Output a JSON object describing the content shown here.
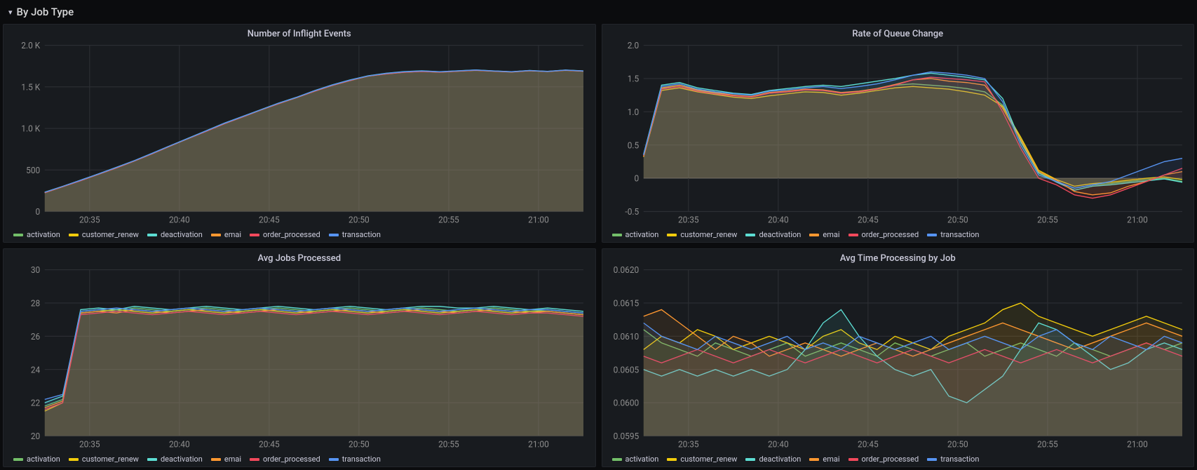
{
  "section": {
    "title": "By Job Type"
  },
  "series_meta": [
    {
      "name": "activation",
      "color": "#73BF69"
    },
    {
      "name": "customer_renew",
      "color": "#F2CC0C"
    },
    {
      "name": "deactivation",
      "color": "#5DDDD3"
    },
    {
      "name": "emai",
      "color": "#FF9830"
    },
    {
      "name": "order_processed",
      "color": "#F2495C"
    },
    {
      "name": "transaction",
      "color": "#5794F2"
    }
  ],
  "x_ticks": [
    "20:35",
    "20:40",
    "20:45",
    "20:50",
    "20:55",
    "21:00"
  ],
  "chart_data": [
    {
      "id": "inflight",
      "type": "line",
      "title": "Number of Inflight Events",
      "xlabel": "",
      "ylabel": "",
      "ylim": [
        0,
        2000
      ],
      "y_ticks": [
        0,
        500,
        1000,
        1500,
        2000
      ],
      "y_tick_labels": [
        "0",
        "500",
        "1.0 K",
        "1.5 K",
        "2.0 K"
      ],
      "x": [
        0,
        1,
        2,
        3,
        4,
        5,
        6,
        7,
        8,
        9,
        10,
        11,
        12,
        13,
        14,
        15,
        16,
        17,
        18,
        19,
        20,
        21,
        22,
        23,
        24,
        25,
        26,
        27,
        28,
        29,
        30
      ],
      "series": [
        {
          "name": "activation",
          "values": [
            230,
            300,
            375,
            450,
            530,
            610,
            700,
            790,
            880,
            970,
            1060,
            1140,
            1220,
            1300,
            1370,
            1450,
            1520,
            1580,
            1630,
            1660,
            1680,
            1690,
            1680,
            1690,
            1700,
            1690,
            1680,
            1695,
            1685,
            1700,
            1690
          ]
        },
        {
          "name": "customer_renew",
          "values": [
            225,
            298,
            370,
            448,
            525,
            608,
            695,
            788,
            878,
            965,
            1055,
            1135,
            1218,
            1295,
            1368,
            1445,
            1515,
            1575,
            1628,
            1655,
            1675,
            1685,
            1676,
            1688,
            1698,
            1688,
            1678,
            1693,
            1683,
            1698,
            1688
          ]
        },
        {
          "name": "deactivation",
          "values": [
            233,
            303,
            378,
            453,
            533,
            613,
            703,
            793,
            883,
            973,
            1063,
            1143,
            1223,
            1303,
            1373,
            1453,
            1523,
            1583,
            1633,
            1663,
            1683,
            1693,
            1682,
            1693,
            1703,
            1692,
            1682,
            1697,
            1687,
            1702,
            1692
          ]
        },
        {
          "name": "emai",
          "values": [
            228,
            301,
            373,
            451,
            528,
            611,
            698,
            791,
            880,
            968,
            1058,
            1138,
            1220,
            1298,
            1370,
            1448,
            1518,
            1578,
            1630,
            1658,
            1678,
            1688,
            1678,
            1690,
            1700,
            1690,
            1680,
            1695,
            1685,
            1700,
            1690
          ]
        },
        {
          "name": "order_processed",
          "values": [
            226,
            299,
            371,
            449,
            526,
            609,
            696,
            789,
            879,
            966,
            1056,
            1136,
            1219,
            1296,
            1369,
            1446,
            1516,
            1576,
            1629,
            1656,
            1676,
            1686,
            1677,
            1689,
            1699,
            1689,
            1679,
            1694,
            1684,
            1699,
            1689
          ]
        },
        {
          "name": "transaction",
          "values": [
            231,
            302,
            376,
            452,
            531,
            612,
            701,
            792,
            881,
            971,
            1061,
            1141,
            1221,
            1301,
            1371,
            1451,
            1521,
            1581,
            1631,
            1661,
            1681,
            1691,
            1681,
            1692,
            1702,
            1691,
            1681,
            1696,
            1686,
            1701,
            1691
          ]
        }
      ]
    },
    {
      "id": "queue-rate",
      "type": "line",
      "title": "Rate of Queue Change",
      "xlabel": "",
      "ylabel": "",
      "ylim": [
        -0.5,
        2.0
      ],
      "y_ticks": [
        -0.5,
        0,
        0.5,
        1.0,
        1.5,
        2.0
      ],
      "y_tick_labels": [
        "-0.5",
        "0",
        "0.5",
        "1.0",
        "1.5",
        "2.0"
      ],
      "x": [
        0,
        1,
        2,
        3,
        4,
        5,
        6,
        7,
        8,
        9,
        10,
        11,
        12,
        13,
        14,
        15,
        16,
        17,
        18,
        19,
        20,
        21,
        22,
        23,
        24,
        25,
        26,
        27,
        28,
        29,
        30
      ],
      "series": [
        {
          "name": "activation",
          "values": [
            0.35,
            1.35,
            1.4,
            1.32,
            1.28,
            1.25,
            1.22,
            1.28,
            1.3,
            1.33,
            1.32,
            1.28,
            1.3,
            1.34,
            1.4,
            1.42,
            1.4,
            1.38,
            1.35,
            1.3,
            1.1,
            0.6,
            0.1,
            -0.05,
            -0.15,
            -0.1,
            -0.08,
            -0.05,
            -0.02,
            0.0,
            -0.05
          ]
        },
        {
          "name": "customer_renew",
          "values": [
            0.32,
            1.32,
            1.36,
            1.3,
            1.26,
            1.22,
            1.2,
            1.24,
            1.27,
            1.3,
            1.29,
            1.25,
            1.28,
            1.32,
            1.36,
            1.38,
            1.36,
            1.34,
            1.3,
            1.25,
            1.08,
            0.62,
            0.12,
            -0.02,
            -0.12,
            -0.08,
            -0.06,
            -0.03,
            0.0,
            0.02,
            -0.02
          ]
        },
        {
          "name": "deactivation",
          "values": [
            0.36,
            1.4,
            1.44,
            1.36,
            1.32,
            1.28,
            1.26,
            1.32,
            1.35,
            1.38,
            1.4,
            1.38,
            1.42,
            1.46,
            1.5,
            1.55,
            1.58,
            1.55,
            1.52,
            1.48,
            1.2,
            0.55,
            0.08,
            -0.06,
            -0.18,
            -0.12,
            -0.1,
            -0.07,
            -0.04,
            -0.01,
            -0.06
          ]
        },
        {
          "name": "emai",
          "values": [
            0.33,
            1.36,
            1.4,
            1.33,
            1.29,
            1.25,
            1.23,
            1.29,
            1.31,
            1.34,
            1.33,
            1.29,
            1.31,
            1.35,
            1.41,
            1.48,
            1.5,
            1.46,
            1.44,
            1.4,
            1.05,
            0.58,
            0.1,
            -0.03,
            -0.2,
            -0.25,
            -0.22,
            -0.12,
            -0.05,
            0.05,
            0.1
          ]
        },
        {
          "name": "order_processed",
          "values": [
            0.34,
            1.34,
            1.38,
            1.31,
            1.27,
            1.24,
            1.22,
            1.28,
            1.3,
            1.33,
            1.32,
            1.28,
            1.3,
            1.34,
            1.4,
            1.48,
            1.52,
            1.5,
            1.48,
            1.45,
            1.0,
            0.45,
            0.0,
            -0.1,
            -0.25,
            -0.3,
            -0.25,
            -0.15,
            -0.05,
            0.05,
            0.15
          ]
        },
        {
          "name": "transaction",
          "values": [
            0.35,
            1.38,
            1.42,
            1.34,
            1.3,
            1.27,
            1.25,
            1.31,
            1.33,
            1.36,
            1.38,
            1.35,
            1.38,
            1.42,
            1.48,
            1.55,
            1.6,
            1.58,
            1.55,
            1.5,
            1.15,
            0.5,
            0.05,
            -0.05,
            -0.15,
            -0.1,
            -0.05,
            0.05,
            0.15,
            0.25,
            0.3
          ]
        }
      ]
    },
    {
      "id": "avg-jobs",
      "type": "line",
      "title": "Avg Jobs Processed",
      "xlabel": "",
      "ylabel": "",
      "ylim": [
        20,
        30
      ],
      "y_ticks": [
        20,
        22,
        24,
        26,
        28,
        30
      ],
      "y_tick_labels": [
        "20",
        "22",
        "24",
        "26",
        "28",
        "30"
      ],
      "x": [
        0,
        1,
        2,
        3,
        4,
        5,
        6,
        7,
        8,
        9,
        10,
        11,
        12,
        13,
        14,
        15,
        16,
        17,
        18,
        19,
        20,
        21,
        22,
        23,
        24,
        25,
        26,
        27,
        28,
        29,
        30
      ],
      "series": [
        {
          "name": "activation",
          "values": [
            21.8,
            22.2,
            27.5,
            27.6,
            27.5,
            27.7,
            27.6,
            27.5,
            27.6,
            27.7,
            27.6,
            27.5,
            27.6,
            27.7,
            27.6,
            27.5,
            27.6,
            27.7,
            27.6,
            27.5,
            27.6,
            27.7,
            27.6,
            27.5,
            27.6,
            27.7,
            27.6,
            27.5,
            27.6,
            27.5,
            27.4
          ]
        },
        {
          "name": "customer_renew",
          "values": [
            21.5,
            22.0,
            27.4,
            27.5,
            27.6,
            27.5,
            27.4,
            27.5,
            27.6,
            27.5,
            27.4,
            27.5,
            27.6,
            27.5,
            27.4,
            27.5,
            27.6,
            27.5,
            27.4,
            27.5,
            27.6,
            27.5,
            27.4,
            27.5,
            27.6,
            27.5,
            27.4,
            27.5,
            27.5,
            27.4,
            27.3
          ]
        },
        {
          "name": "deactivation",
          "values": [
            22.0,
            22.4,
            27.6,
            27.7,
            27.6,
            27.8,
            27.7,
            27.6,
            27.7,
            27.8,
            27.7,
            27.6,
            27.7,
            27.8,
            27.7,
            27.6,
            27.7,
            27.8,
            27.7,
            27.6,
            27.7,
            27.8,
            27.8,
            27.7,
            27.7,
            27.8,
            27.7,
            27.6,
            27.7,
            27.6,
            27.5
          ]
        },
        {
          "name": "emai",
          "values": [
            21.7,
            22.1,
            27.4,
            27.5,
            27.4,
            27.6,
            27.5,
            27.4,
            27.5,
            27.6,
            27.5,
            27.4,
            27.5,
            27.6,
            27.5,
            27.4,
            27.5,
            27.6,
            27.5,
            27.4,
            27.5,
            27.6,
            27.5,
            27.4,
            27.5,
            27.6,
            27.5,
            27.4,
            27.5,
            27.4,
            27.3
          ]
        },
        {
          "name": "order_processed",
          "values": [
            21.6,
            22.0,
            27.3,
            27.4,
            27.5,
            27.4,
            27.3,
            27.4,
            27.5,
            27.4,
            27.3,
            27.4,
            27.5,
            27.4,
            27.3,
            27.4,
            27.5,
            27.4,
            27.3,
            27.4,
            27.5,
            27.4,
            27.3,
            27.4,
            27.5,
            27.4,
            27.3,
            27.4,
            27.4,
            27.3,
            27.2
          ]
        },
        {
          "name": "transaction",
          "values": [
            22.2,
            22.5,
            27.5,
            27.6,
            27.7,
            27.6,
            27.5,
            27.6,
            27.7,
            27.6,
            27.5,
            27.6,
            27.7,
            27.6,
            27.5,
            27.6,
            27.7,
            27.6,
            27.5,
            27.6,
            27.7,
            27.6,
            27.5,
            27.6,
            27.7,
            27.6,
            27.5,
            27.6,
            27.6,
            27.5,
            27.4
          ]
        }
      ]
    },
    {
      "id": "avg-time",
      "type": "line",
      "title": "Avg Time Processing by Job",
      "xlabel": "",
      "ylabel": "",
      "ylim": [
        0.0595,
        0.062
      ],
      "y_ticks": [
        0.0595,
        0.06,
        0.0605,
        0.061,
        0.0615,
        0.062
      ],
      "y_tick_labels": [
        "0.0595",
        "0.0600",
        "0.0605",
        "0.0610",
        "0.0615",
        "0.0620"
      ],
      "x": [
        0,
        1,
        2,
        3,
        4,
        5,
        6,
        7,
        8,
        9,
        10,
        11,
        12,
        13,
        14,
        15,
        16,
        17,
        18,
        19,
        20,
        21,
        22,
        23,
        24,
        25,
        26,
        27,
        28,
        29,
        30
      ],
      "series": [
        {
          "name": "activation",
          "values": [
            0.0611,
            0.0609,
            0.0608,
            0.0607,
            0.0609,
            0.0608,
            0.0607,
            0.0608,
            0.0609,
            0.0607,
            0.0608,
            0.0609,
            0.0608,
            0.0607,
            0.0609,
            0.0608,
            0.0607,
            0.0608,
            0.0609,
            0.0607,
            0.0608,
            0.0609,
            0.0608,
            0.0607,
            0.0609,
            0.0608,
            0.0607,
            0.0608,
            0.0609,
            0.0608,
            0.0609
          ]
        },
        {
          "name": "customer_renew",
          "values": [
            0.0608,
            0.061,
            0.0609,
            0.0611,
            0.061,
            0.0608,
            0.0609,
            0.061,
            0.0609,
            0.0608,
            0.061,
            0.0611,
            0.0609,
            0.0608,
            0.061,
            0.0609,
            0.0608,
            0.061,
            0.0611,
            0.0612,
            0.0614,
            0.0615,
            0.0613,
            0.0612,
            0.0611,
            0.061,
            0.0611,
            0.0612,
            0.0613,
            0.0612,
            0.0611
          ]
        },
        {
          "name": "deactivation",
          "values": [
            0.0605,
            0.0604,
            0.0605,
            0.0604,
            0.0605,
            0.0604,
            0.0605,
            0.0604,
            0.0605,
            0.0608,
            0.0612,
            0.0614,
            0.061,
            0.0607,
            0.0605,
            0.0604,
            0.0605,
            0.0601,
            0.06,
            0.0602,
            0.0604,
            0.0608,
            0.0612,
            0.0611,
            0.0609,
            0.0607,
            0.0605,
            0.0606,
            0.0608,
            0.0609,
            0.0608
          ]
        },
        {
          "name": "emai",
          "values": [
            0.0613,
            0.0614,
            0.0612,
            0.061,
            0.0608,
            0.061,
            0.0609,
            0.0607,
            0.0608,
            0.0609,
            0.0608,
            0.0607,
            0.0608,
            0.0609,
            0.0608,
            0.0607,
            0.0608,
            0.0609,
            0.061,
            0.0611,
            0.0612,
            0.0611,
            0.061,
            0.0609,
            0.0608,
            0.0609,
            0.061,
            0.0611,
            0.0612,
            0.0611,
            0.061
          ]
        },
        {
          "name": "order_processed",
          "values": [
            0.0607,
            0.0606,
            0.0607,
            0.0608,
            0.0607,
            0.0606,
            0.0607,
            0.0608,
            0.0607,
            0.0606,
            0.0607,
            0.0608,
            0.0607,
            0.0606,
            0.0607,
            0.0608,
            0.0607,
            0.0606,
            0.0607,
            0.0608,
            0.0607,
            0.0606,
            0.0607,
            0.0608,
            0.0607,
            0.0606,
            0.0607,
            0.0608,
            0.0609,
            0.0608,
            0.0607
          ]
        },
        {
          "name": "transaction",
          "values": [
            0.0612,
            0.061,
            0.0609,
            0.0608,
            0.061,
            0.0609,
            0.0608,
            0.0609,
            0.061,
            0.0608,
            0.0609,
            0.0608,
            0.061,
            0.0609,
            0.0608,
            0.0609,
            0.061,
            0.0608,
            0.0609,
            0.061,
            0.0609,
            0.0608,
            0.061,
            0.0611,
            0.0609,
            0.0608,
            0.061,
            0.0609,
            0.0608,
            0.061,
            0.0609
          ]
        }
      ]
    }
  ]
}
